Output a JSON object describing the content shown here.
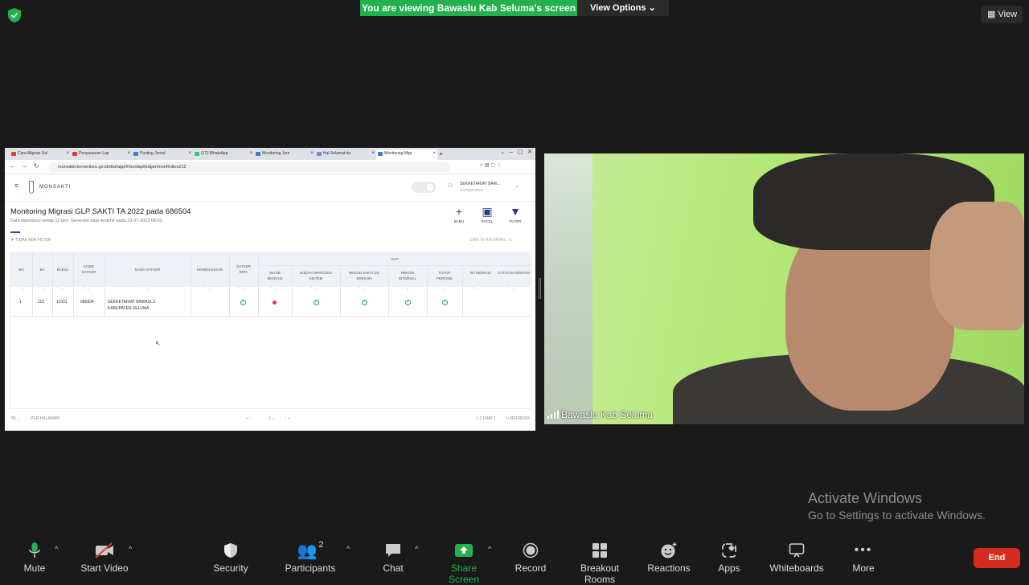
{
  "banner": {
    "text": "You are viewing Bawaslu Kab Seluma's screen",
    "view_options": "View Options",
    "view": "View"
  },
  "browser": {
    "tabs": [
      {
        "label": "Cara Migrasi Sal",
        "color": "#e53935"
      },
      {
        "label": "Penyusunan Lap",
        "color": "#e53935"
      },
      {
        "label": "Posting Jurnal",
        "color": "#3b7dd8"
      },
      {
        "label": "(17) WhatsApp",
        "color": "#25d366"
      },
      {
        "label": "Monitoring Jurn",
        "color": "#3b7dd8"
      },
      {
        "label": "Hal Selamat da",
        "color": "#6b8ed6"
      },
      {
        "label": "Monitoring Migr",
        "color": "#3b7dd8"
      }
    ],
    "url": "monsakti.kemenkeu.go.id/dist/app/#monlap/ledger/monRollout/12"
  },
  "app": {
    "logo": "MONSAKTI",
    "user_name": "SEKRETARIAT BAW...",
    "user_role": "SATKER 2022",
    "title": "Monitoring Migrasi GLP SAKTI TA 2022 pada 686504",
    "subtitle": "Data diperbarui setiap 12 jam. Generate data terakhir pada 19-07-2022 06:03",
    "actions": {
      "new": "BARU",
      "excel": "EXCEL",
      "filter": "FILTER"
    },
    "no_filter": "TIDAK ADA FILTER",
    "search_placeholder": "CARI DI HALAMAN...",
    "columns": {
      "no": "NO",
      "ba": "BA",
      "baes1": "BAES1",
      "kode_satker": "KODE SATKER",
      "nama_satker": "NAMA SATKER",
      "kewenangan": "KEWENANGAN",
      "satker_dipa": "SATKER DIPA",
      "glp": "GLP",
      "wajib_migrasi": "WAJIB MIGRASI",
      "sudah_diproses": "SUDAH DIPROSES SISTEM",
      "rekon_sakti": "REKON SAKTI DG EREKON",
      "rekon_internal": "REKON INTERNAL",
      "tutup_periode": "TUTUP PERIODE",
      "ba_migrasi": "BA MIGRASI",
      "catatan": "CATATAN MIGRASI"
    },
    "row": {
      "no": "1",
      "ba": "115",
      "baes1": "11501",
      "kode_satker": "686504",
      "nama_satker": "SEKRETARIAT BAWASLU KABUPATEN SELUMA"
    },
    "footer": {
      "page_size": "50",
      "per_page": "PER HALAMAN",
      "page": "1",
      "range": "1-1 DARI 1",
      "refresh": "REFRESH"
    }
  },
  "camera": {
    "name": "Bawaslu Kab Seluma"
  },
  "watermark": {
    "line1": "Activate Windows",
    "line2": "Go to Settings to activate Windows."
  },
  "toolbar": {
    "mute": "Mute",
    "start_video": "Start Video",
    "security": "Security",
    "participants": "Participants",
    "participant_count": "2",
    "chat": "Chat",
    "share_screen": "Share Screen",
    "record": "Record",
    "breakout": "Breakout Rooms",
    "reactions": "Reactions",
    "apps": "Apps",
    "whiteboards": "Whiteboards",
    "more": "More",
    "end": "End"
  },
  "colors": {
    "share_green": "#23b14d",
    "end_red": "#d52b1e",
    "mic_green": "#23b14d"
  }
}
